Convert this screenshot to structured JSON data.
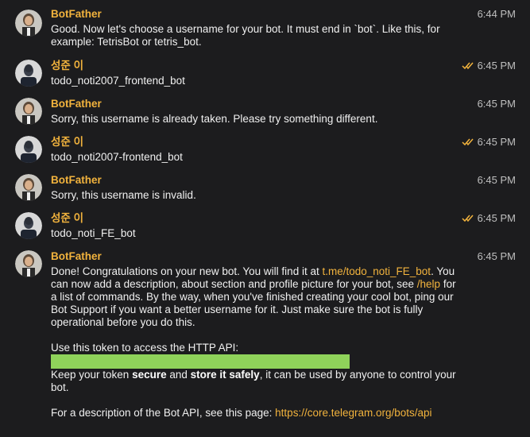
{
  "messages": [
    {
      "sender": "BotFather",
      "time": "6:44 PM",
      "lines": [
        "Good. Now let's choose a username for your bot. It must end in `bot`. Like this, for",
        "example: TetrisBot or tetris_bot."
      ]
    },
    {
      "sender": "성준 이",
      "time": "6:45 PM",
      "read": true,
      "text": "todo_noti2007_frontend_bot"
    },
    {
      "sender": "BotFather",
      "time": "6:45 PM",
      "text": "Sorry, this username is already taken. Please try something different."
    },
    {
      "sender": "성준 이",
      "time": "6:45 PM",
      "read": true,
      "text": "todo_noti2007-frontend_bot"
    },
    {
      "sender": "BotFather",
      "time": "6:45 PM",
      "text": "Sorry, this username is invalid."
    },
    {
      "sender": "성준 이",
      "time": "6:45 PM",
      "read": true,
      "text": "todo_noti_FE_bot"
    },
    {
      "sender": "BotFather",
      "time": "6:45 PM",
      "final": {
        "p1_pre": "Done! Congratulations on your new bot. You will find it at ",
        "p1_link": "t.me/todo_noti_FE_bot",
        "p1_mid": ". You can now add a description, about section and profile picture for your bot, see ",
        "p1_cmd": "/help",
        "p1_post": " for a list of commands. By the way, when you've finished creating your cool bot, ping our Bot Support if you want a better username for it. Just make sure the bot is fully operational before you do this.",
        "token_label": "Use this token to access the HTTP API:",
        "keep_pre": "Keep your token ",
        "keep_bold1": "secure",
        "keep_mid": " and ",
        "keep_bold2": "store it safely",
        "keep_post": ", it can be used by anyone to control your bot.",
        "api_pre": "For a description of the Bot API, see this page: ",
        "api_link": "https://core.telegram.org/bots/api"
      }
    }
  ],
  "colors": {
    "background": "#1c1c1e",
    "sender": "#f2b33d",
    "link": "#f2b33d",
    "token_redaction": "#8fd25a",
    "timestamp": "#bfbfbf"
  },
  "icons": {
    "botfather_avatar": "botfather-avatar",
    "user_avatar": "user-avatar",
    "read_status": "double-check-icon"
  }
}
